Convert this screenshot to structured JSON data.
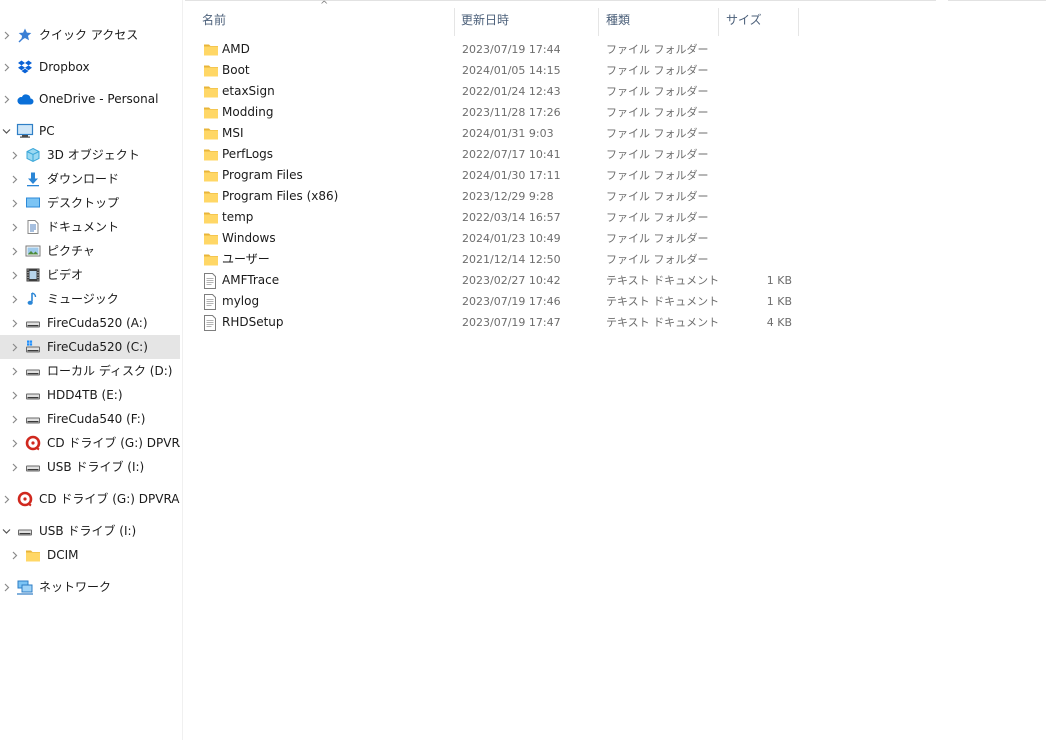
{
  "nav": {
    "items": [
      {
        "label": "クイック アクセス",
        "icon": "star-icon",
        "level": 0,
        "expander": "collapsed",
        "selected": false
      },
      {
        "label": "Dropbox",
        "icon": "dropbox-icon",
        "level": 0,
        "expander": "collapsed",
        "selected": false
      },
      {
        "label": "OneDrive - Personal",
        "icon": "cloud-icon",
        "level": 0,
        "expander": "collapsed",
        "selected": false
      },
      {
        "label": "PC",
        "icon": "pc-icon",
        "level": 0,
        "expander": "expanded",
        "selected": false
      },
      {
        "label": "3D オブジェクト",
        "icon": "3d-objects-icon",
        "level": 1,
        "expander": "collapsed",
        "selected": false
      },
      {
        "label": "ダウンロード",
        "icon": "download-icon",
        "level": 1,
        "expander": "collapsed",
        "selected": false
      },
      {
        "label": "デスクトップ",
        "icon": "desktop-icon",
        "level": 1,
        "expander": "collapsed",
        "selected": false
      },
      {
        "label": "ドキュメント",
        "icon": "document-icon",
        "level": 1,
        "expander": "collapsed",
        "selected": false
      },
      {
        "label": "ピクチャ",
        "icon": "picture-icon",
        "level": 1,
        "expander": "collapsed",
        "selected": false
      },
      {
        "label": "ビデオ",
        "icon": "video-icon",
        "level": 1,
        "expander": "collapsed",
        "selected": false
      },
      {
        "label": "ミュージック",
        "icon": "music-icon",
        "level": 1,
        "expander": "collapsed",
        "selected": false
      },
      {
        "label": "FireCuda520 (A:)",
        "icon": "drive-icon",
        "level": 1,
        "expander": "collapsed",
        "selected": false
      },
      {
        "label": "FireCuda520 (C:)",
        "icon": "windows-drive-icon",
        "level": 1,
        "expander": "collapsed",
        "selected": true
      },
      {
        "label": "ローカル ディスク (D:)",
        "icon": "drive-icon",
        "level": 1,
        "expander": "collapsed",
        "selected": false
      },
      {
        "label": "HDD4TB (E:)",
        "icon": "drive-icon",
        "level": 1,
        "expander": "collapsed",
        "selected": false
      },
      {
        "label": "FireCuda540 (F:)",
        "icon": "drive-icon",
        "level": 1,
        "expander": "collapsed",
        "selected": false
      },
      {
        "label": "CD ドライブ (G:) DPVRAssistant",
        "icon": "cd-drive-icon",
        "level": 1,
        "expander": "collapsed",
        "selected": false
      },
      {
        "label": "USB ドライブ (I:)",
        "icon": "usb-drive-icon",
        "level": 1,
        "expander": "collapsed",
        "selected": false
      },
      {
        "label": "CD ドライブ (G:) DPVRAssistant",
        "icon": "cd-drive-icon",
        "level": 0,
        "expander": "collapsed",
        "selected": false
      },
      {
        "label": "USB ドライブ (I:)",
        "icon": "usb-drive-icon",
        "level": 0,
        "expander": "expanded",
        "selected": false
      },
      {
        "label": "DCIM",
        "icon": "folder-icon",
        "level": 1,
        "expander": "collapsed",
        "selected": false
      },
      {
        "label": "ネットワーク",
        "icon": "network-icon",
        "level": 0,
        "expander": "collapsed",
        "selected": false
      }
    ]
  },
  "columns": {
    "name": "名前",
    "date": "更新日時",
    "type": "種類",
    "size": "サイズ"
  },
  "sort_indicator": "^",
  "files": [
    {
      "name": "AMD",
      "date": "2023/07/19 17:44",
      "type": "ファイル フォルダー",
      "size": "",
      "icon": "folder-icon"
    },
    {
      "name": "Boot",
      "date": "2024/01/05 14:15",
      "type": "ファイル フォルダー",
      "size": "",
      "icon": "folder-icon"
    },
    {
      "name": "etaxSign",
      "date": "2022/01/24 12:43",
      "type": "ファイル フォルダー",
      "size": "",
      "icon": "folder-icon"
    },
    {
      "name": "Modding",
      "date": "2023/11/28 17:26",
      "type": "ファイル フォルダー",
      "size": "",
      "icon": "folder-icon"
    },
    {
      "name": "MSI",
      "date": "2024/01/31 9:03",
      "type": "ファイル フォルダー",
      "size": "",
      "icon": "folder-icon"
    },
    {
      "name": "PerfLogs",
      "date": "2022/07/17 10:41",
      "type": "ファイル フォルダー",
      "size": "",
      "icon": "folder-icon"
    },
    {
      "name": "Program Files",
      "date": "2024/01/30 17:11",
      "type": "ファイル フォルダー",
      "size": "",
      "icon": "folder-icon"
    },
    {
      "name": "Program Files (x86)",
      "date": "2023/12/29 9:28",
      "type": "ファイル フォルダー",
      "size": "",
      "icon": "folder-icon"
    },
    {
      "name": "temp",
      "date": "2022/03/14 16:57",
      "type": "ファイル フォルダー",
      "size": "",
      "icon": "folder-icon"
    },
    {
      "name": "Windows",
      "date": "2024/01/23 10:49",
      "type": "ファイル フォルダー",
      "size": "",
      "icon": "folder-icon"
    },
    {
      "name": "ユーザー",
      "date": "2021/12/14 12:50",
      "type": "ファイル フォルダー",
      "size": "",
      "icon": "folder-icon"
    },
    {
      "name": "AMFTrace",
      "date": "2023/02/27 10:42",
      "type": "テキスト ドキュメント",
      "size": "1 KB",
      "icon": "text-file-icon"
    },
    {
      "name": "mylog",
      "date": "2023/07/19 17:46",
      "type": "テキスト ドキュメント",
      "size": "1 KB",
      "icon": "text-file-icon"
    },
    {
      "name": "RHDSetup",
      "date": "2023/07/19 17:47",
      "type": "テキスト ドキュメント",
      "size": "4 KB",
      "icon": "text-file-icon"
    }
  ],
  "colors": {
    "selection": "#e5e5e5",
    "folder": "#ffd766",
    "header_text": "#4c607a",
    "secondary_text": "#6d6d6d"
  }
}
